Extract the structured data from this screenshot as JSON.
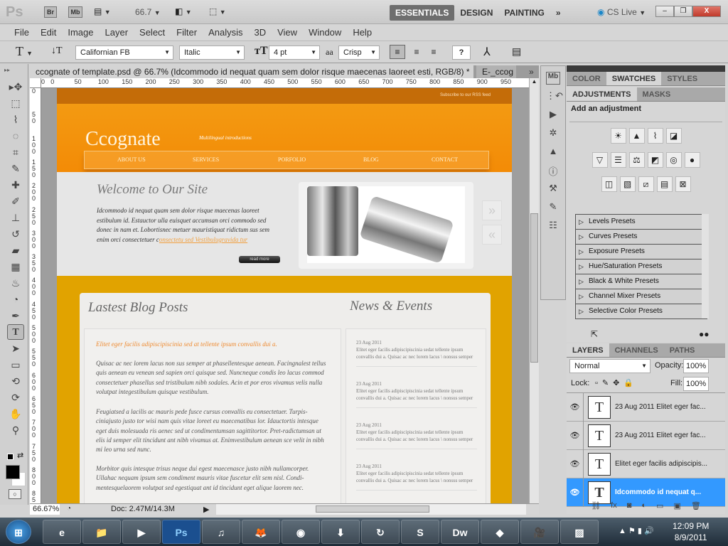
{
  "app": {
    "logo": "Ps",
    "quick_buttons": [
      "Br",
      "Mb"
    ],
    "zoom_value": "66.7",
    "workspaces": [
      "ESSENTIALS",
      "DESIGN",
      "PAINTING"
    ],
    "more_label": "»",
    "cs_live": "CS Live",
    "window_controls": {
      "minimize": "–",
      "restore": "❐",
      "close": "X"
    }
  },
  "menu": [
    "File",
    "Edit",
    "Image",
    "Layer",
    "Select",
    "Filter",
    "Analysis",
    "3D",
    "View",
    "Window",
    "Help"
  ],
  "options": {
    "tool_glyph": "T",
    "font_family": "Californian FB",
    "font_style": "Italic",
    "font_size": "4 pt",
    "aa_label": "aa",
    "antialias": "Crisp",
    "color_label": "?"
  },
  "tools": [
    {
      "name": "move-tool",
      "glyph": "▸✥"
    },
    {
      "name": "marquee-tool",
      "glyph": "⬚"
    },
    {
      "name": "lasso-tool",
      "glyph": "⌇"
    },
    {
      "name": "quick-selection-tool",
      "glyph": "◌"
    },
    {
      "name": "crop-tool",
      "glyph": "⌗"
    },
    {
      "name": "eyedropper-tool",
      "glyph": "✎"
    },
    {
      "name": "healing-brush-tool",
      "glyph": "✚"
    },
    {
      "name": "brush-tool",
      "glyph": "✐"
    },
    {
      "name": "clone-stamp-tool",
      "glyph": "⊥"
    },
    {
      "name": "history-brush-tool",
      "glyph": "↺"
    },
    {
      "name": "eraser-tool",
      "glyph": "▰"
    },
    {
      "name": "gradient-tool",
      "glyph": "▦"
    },
    {
      "name": "blur-tool",
      "glyph": "♨"
    },
    {
      "name": "dodge-tool",
      "glyph": "◔"
    },
    {
      "name": "pen-tool",
      "glyph": "✒"
    },
    {
      "name": "type-tool",
      "glyph": "T",
      "active": true
    },
    {
      "name": "path-selection-tool",
      "glyph": "➤"
    },
    {
      "name": "rectangle-tool",
      "glyph": "▭"
    },
    {
      "name": "3d-rotate-tool",
      "glyph": "⟲"
    },
    {
      "name": "3d-orbit-tool",
      "glyph": "⟳"
    },
    {
      "name": "hand-tool",
      "glyph": "✋"
    },
    {
      "name": "zoom-tool",
      "glyph": "⚲"
    }
  ],
  "document": {
    "tab_title": "ccognate of template.psd @ 66.7% (Idcommodo id nequat quam sem dolor risque maecenas laoreet esti, RGB/8) *",
    "tab_close": "✕",
    "second_tab": "E-_ccog",
    "tabs_more": "»",
    "ruler_h_ticks": [
      "0",
      "0",
      "50",
      "100",
      "150",
      "200",
      "250",
      "300",
      "350",
      "400",
      "450",
      "500",
      "550",
      "600",
      "650",
      "700",
      "750",
      "800",
      "850",
      "900",
      "950"
    ],
    "ruler_v_ticks": [
      "0",
      "50",
      "100",
      "150",
      "200",
      "250",
      "300",
      "350",
      "400",
      "450",
      "500",
      "550",
      "600",
      "650",
      "700",
      "750",
      "800",
      "85"
    ],
    "status_zoom": "66.67%",
    "status_doc": "Doc: 2.47M/14.3M"
  },
  "site": {
    "rss": "Subscribe to our RSS feed",
    "logo": "Ccognate",
    "tagline": "Multilingual introductions",
    "nav": [
      "ABOUT US",
      "SERVICES",
      "PORFOLIO",
      "BLOG",
      "CONTACT"
    ],
    "welcome_title": "Welcome  to Our Site",
    "welcome_body": "Idcommodo id nequat quam sem dolor risque maecenas laoreet estibulum id. Estauctor ulla euisquet accumsan orci commodo sed donec in nam et. Lobortisnec metuer mauristiquat ridictum sus sem enim orci consectetuer c",
    "welcome_link": "onsectetu sed Vestibulugravida tur",
    "more_button": "read more",
    "slider_next": "»",
    "slider_prev": "«",
    "blog_title": "Lastest Blog Posts",
    "blog_lead": "Elitet eger facilis adipiscipiscinia sed at tellente ipsum convallis dui a.",
    "blog_paragraphs": [
      "Quisac ac nec lorem lacus non sus semper at phasellentesque aenean. Facingnalest tellus quis aenean eu venean sed sapien orci quisque sed. Nuncneque condis leo lacus commod consectetuer phasellus sed tristibulum nibh sodales. Acin et por eros vivamus velis nulla volutpat integestibulum quisque vestibulum.",
      "Feugiatsed a lacilis ac mauris pede fusce cursus convallis eu consectetuer. Turpis-ciniajusto justo tor wisi nam quis vitae loreet eu maecenatibus lor. Idauctortis intesque eget duis molesuada ris aenec sed ut condimentumsan sagittitortor. Pret-radictumsan ut elis id semper elit tincidunt ant nibh vivamus at. Enimvestibulum aenean sce velit in nibh mi leo urna sed nunc.",
      "Morbitor quis intesque trisus neque dui egest maecenasce justo nibh nullamcorper. Ullahac nequam ipsum sem condiment mauris vitae fuscetur elit sem nisl. Condi-mentesquelaorem volutpat sed egestiquat ant id tincidunt eget alique laorem nec."
    ],
    "news_title": "News & Events",
    "news": [
      {
        "date": "23 Aug 2011",
        "text": "Elitet eger facilis adipiscipiscinia sedat tellente ipsum convallis dui a. Quisac ac nec lorem lacus \\ nonsus semper"
      },
      {
        "date": "23 Aug 2011",
        "text": "Elitet eger facilis adipiscipiscinia sedat tellente ipsum convallis dui a. Quisac ac nec lorem lacus \\ nonsus semper"
      },
      {
        "date": "23 Aug 2011",
        "text": "Elitet eger facilis adipiscipiscinia sedat tellente ipsum convallis dui a. Quisac ac nec lorem lacus \\ nonsus semper"
      },
      {
        "date": "23 Aug 2011",
        "text": "Elitet eger facilis adipiscipiscinia sedat tellente ipsum convallis dui a. Quisac ac nec lorem lacus \\ nonsus semper"
      }
    ]
  },
  "panels": {
    "top_tabs": [
      "COLOR",
      "SWATCHES",
      "STYLES"
    ],
    "adj_tabs": [
      "ADJUSTMENTS",
      "MASKS"
    ],
    "adj_heading": "Add an adjustment",
    "adj_icons_row1": [
      "☀",
      "▲",
      "⌇",
      "◪"
    ],
    "adj_icons_row2": [
      "▽",
      "☰",
      "⚖",
      "◩",
      "◎",
      "●"
    ],
    "adj_icons_row3": [
      "◫",
      "▧",
      "⧄",
      "▤",
      "⊠"
    ],
    "presets": [
      "Levels Presets",
      "Curves Presets",
      "Exposure Presets",
      "Hue/Saturation Presets",
      "Black & White Presets",
      "Channel Mixer Presets",
      "Selective Color Presets"
    ],
    "layer_tabs": [
      "LAYERS",
      "CHANNELS",
      "PATHS"
    ],
    "blend_mode": "Normal",
    "opacity_label": "Opacity:",
    "opacity": "100%",
    "lock_label": "Lock:",
    "fill_label": "Fill:",
    "fill": "100%",
    "layers": [
      {
        "name": "23 Aug 2011 Elitet eger fac...",
        "selected": false
      },
      {
        "name": "23 Aug 2011 Elitet eger fac...",
        "selected": false
      },
      {
        "name": "Elitet eger facilis adipiscipis...",
        "selected": false
      },
      {
        "name": "Idcommodo id nequat q...",
        "selected": true
      }
    ],
    "layer_footer_icons": [
      "⛓",
      "fx",
      "◙",
      "◐",
      "▭",
      "▣",
      "🗑"
    ]
  },
  "dock_icons": [
    "Mb",
    "⋮↶",
    "▶",
    "✲",
    "▲",
    "ⓘ",
    "⚒",
    "✎",
    "☷"
  ],
  "taskbar": {
    "apps": [
      "⊞",
      "e",
      "📁",
      "▶",
      "Ps",
      "♫",
      "🦊",
      "◉",
      "⬇",
      "↻",
      "S",
      "Dw",
      "◆",
      "🎥",
      "▨"
    ],
    "time": "12:09 PM",
    "date": "8/9/2011"
  }
}
